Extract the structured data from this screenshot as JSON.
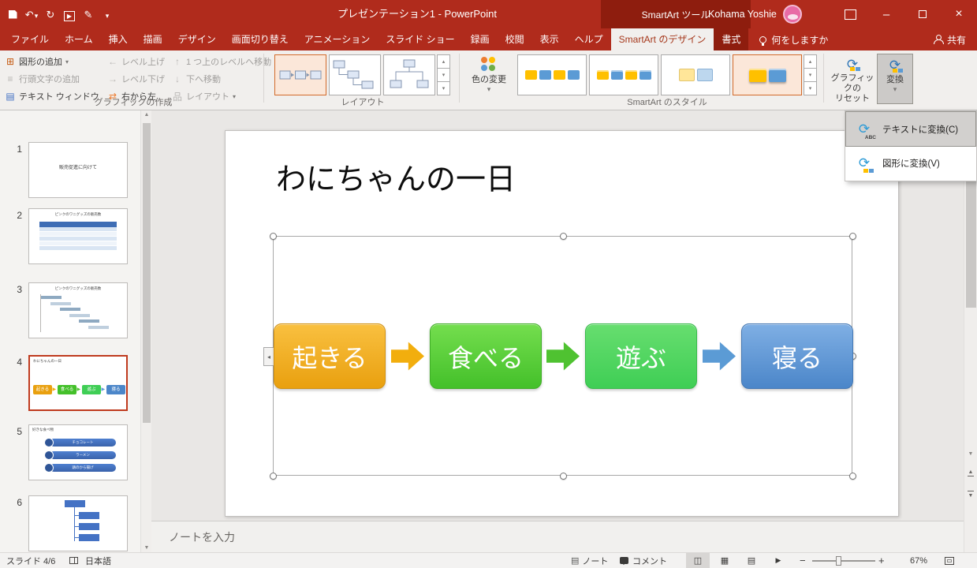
{
  "colors": {
    "titlebar": "#B02B1C",
    "titlebar_dark": "#8E1D0E",
    "ribbon_bg": "#F1EFED",
    "accent": "#A5371B",
    "selected_slide_border": "#BF3A1E"
  },
  "icons": {
    "save": "floppy-shape",
    "undo": "↶",
    "redo": "↻",
    "start-slideshow": "▶",
    "pen": "✎",
    "qat-menu": "▾",
    "lightbulb": "bulb-shape",
    "share-person": "person-shape",
    "minimize": "–",
    "maximize": "square-shape",
    "close": "×",
    "add-shape": "⊞",
    "add-bullet": "≡",
    "text-pane": "▤",
    "promote": "←",
    "demote": "→",
    "right-to-left": "⇄",
    "move-up": "↑",
    "move-down": "↓",
    "layout": "品",
    "dropdown-caret": "▾",
    "convert-arrows": "⟳",
    "view-normal": "◫",
    "view-sorter": "▦",
    "view-reading": "▤",
    "view-slideshow": "▶"
  },
  "titlebar": {
    "title": "プレゼンテーション1 - PowerPoint",
    "contextual_header": "SmartArt ツール",
    "user_name": "Kohama Yoshie"
  },
  "ribbon_tabs": [
    {
      "key": "file",
      "label": "ファイル"
    },
    {
      "key": "home",
      "label": "ホーム"
    },
    {
      "key": "insert",
      "label": "挿入"
    },
    {
      "key": "draw",
      "label": "描画"
    },
    {
      "key": "design",
      "label": "デザイン"
    },
    {
      "key": "transitions",
      "label": "画面切り替え"
    },
    {
      "key": "animations",
      "label": "アニメーション"
    },
    {
      "key": "slideshow",
      "label": "スライド ショー"
    },
    {
      "key": "record",
      "label": "録画"
    },
    {
      "key": "review",
      "label": "校閲"
    },
    {
      "key": "view",
      "label": "表示"
    },
    {
      "key": "help",
      "label": "ヘルプ"
    },
    {
      "key": "smartart-design",
      "label": "SmartArt のデザイン",
      "contextual": true,
      "active": true
    },
    {
      "key": "format",
      "label": "書式",
      "contextual": true
    }
  ],
  "tell_me": "何をしますか",
  "share_label": "共有",
  "ribbon": {
    "groups": {
      "create": {
        "label": "グラフィックの作成",
        "items": [
          {
            "key": "add-shape",
            "icon": "add-shape",
            "label": "図形の追加",
            "enabled": true,
            "dropdown": true
          },
          {
            "key": "add-bullet",
            "icon": "add-bullet",
            "label": "行頭文字の追加",
            "enabled": false
          },
          {
            "key": "text-pane",
            "icon": "text-pane",
            "label": "テキスト ウィンドウ",
            "enabled": true
          },
          {
            "key": "promote",
            "icon": "promote",
            "label": "レベル上げ",
            "enabled": false
          },
          {
            "key": "demote",
            "icon": "demote",
            "label": "レベル下げ",
            "enabled": false
          },
          {
            "key": "right-to-left",
            "icon": "right-to-left",
            "label": "右から左",
            "enabled": true
          },
          {
            "key": "move-up",
            "icon": "move-up",
            "label": "1 つ上のレベルへ移動",
            "enabled": false
          },
          {
            "key": "move-down",
            "icon": "move-down",
            "label": "下へ移動",
            "enabled": false
          },
          {
            "key": "layout",
            "icon": "layout",
            "label": "レイアウト",
            "enabled": false,
            "dropdown": true
          }
        ]
      },
      "layouts": {
        "label": "レイアウト"
      },
      "styles": {
        "label": "SmartArt のスタイル",
        "change_colors": "色の変更"
      },
      "reset": {
        "line1": "グラフィックの",
        "line2": "リセット"
      },
      "convert": {
        "label": "変換"
      }
    }
  },
  "convert_menu": {
    "items": [
      {
        "key": "convert-to-text",
        "label": "テキストに変換(C)",
        "highlighted": true
      },
      {
        "key": "convert-to-shapes",
        "label": "図形に変換(V)",
        "highlighted": false
      }
    ]
  },
  "slide_panel": {
    "slides": [
      {
        "num": "1",
        "type": "title",
        "title": "販売促進に向けて"
      },
      {
        "num": "2",
        "type": "table",
        "title": "ピンクのワニグッズの販売数"
      },
      {
        "num": "3",
        "type": "gantt",
        "title": "ピンクのワニグッズの販売数"
      },
      {
        "num": "4",
        "type": "process",
        "title": "わにちゃんの一日",
        "selected": true
      },
      {
        "num": "5",
        "type": "list",
        "title": "好きな食べ物",
        "items": [
          "チョコレート",
          "ラーメン",
          "鶏のから揚げ"
        ]
      },
      {
        "num": "6",
        "type": "org"
      }
    ]
  },
  "slide": {
    "title": "わにちゃんの一日",
    "smartart": {
      "shapes": [
        {
          "label": "起きる",
          "top": "#F9C040",
          "bottom": "#E9A00F",
          "border": "#D29110"
        },
        {
          "label": "食べる",
          "top": "#74DE4E",
          "bottom": "#44C02A",
          "border": "#3FAE26"
        },
        {
          "label": "遊ぶ",
          "top": "#67DE6F",
          "bottom": "#3FCE55",
          "border": "#39BA4C"
        },
        {
          "label": "寝る",
          "top": "#7FAFE4",
          "bottom": "#4B86C9",
          "border": "#4478B4"
        }
      ],
      "arrows": [
        "#F2AE0E",
        "#4FC231",
        "#5B9BD5"
      ]
    }
  },
  "notes": {
    "placeholder": "ノートを入力"
  },
  "status": {
    "slide_indicator": "スライド 4/6",
    "language": "日本語",
    "notes_btn": "ノート",
    "comments_btn": "コメント",
    "zoom": "67%"
  }
}
